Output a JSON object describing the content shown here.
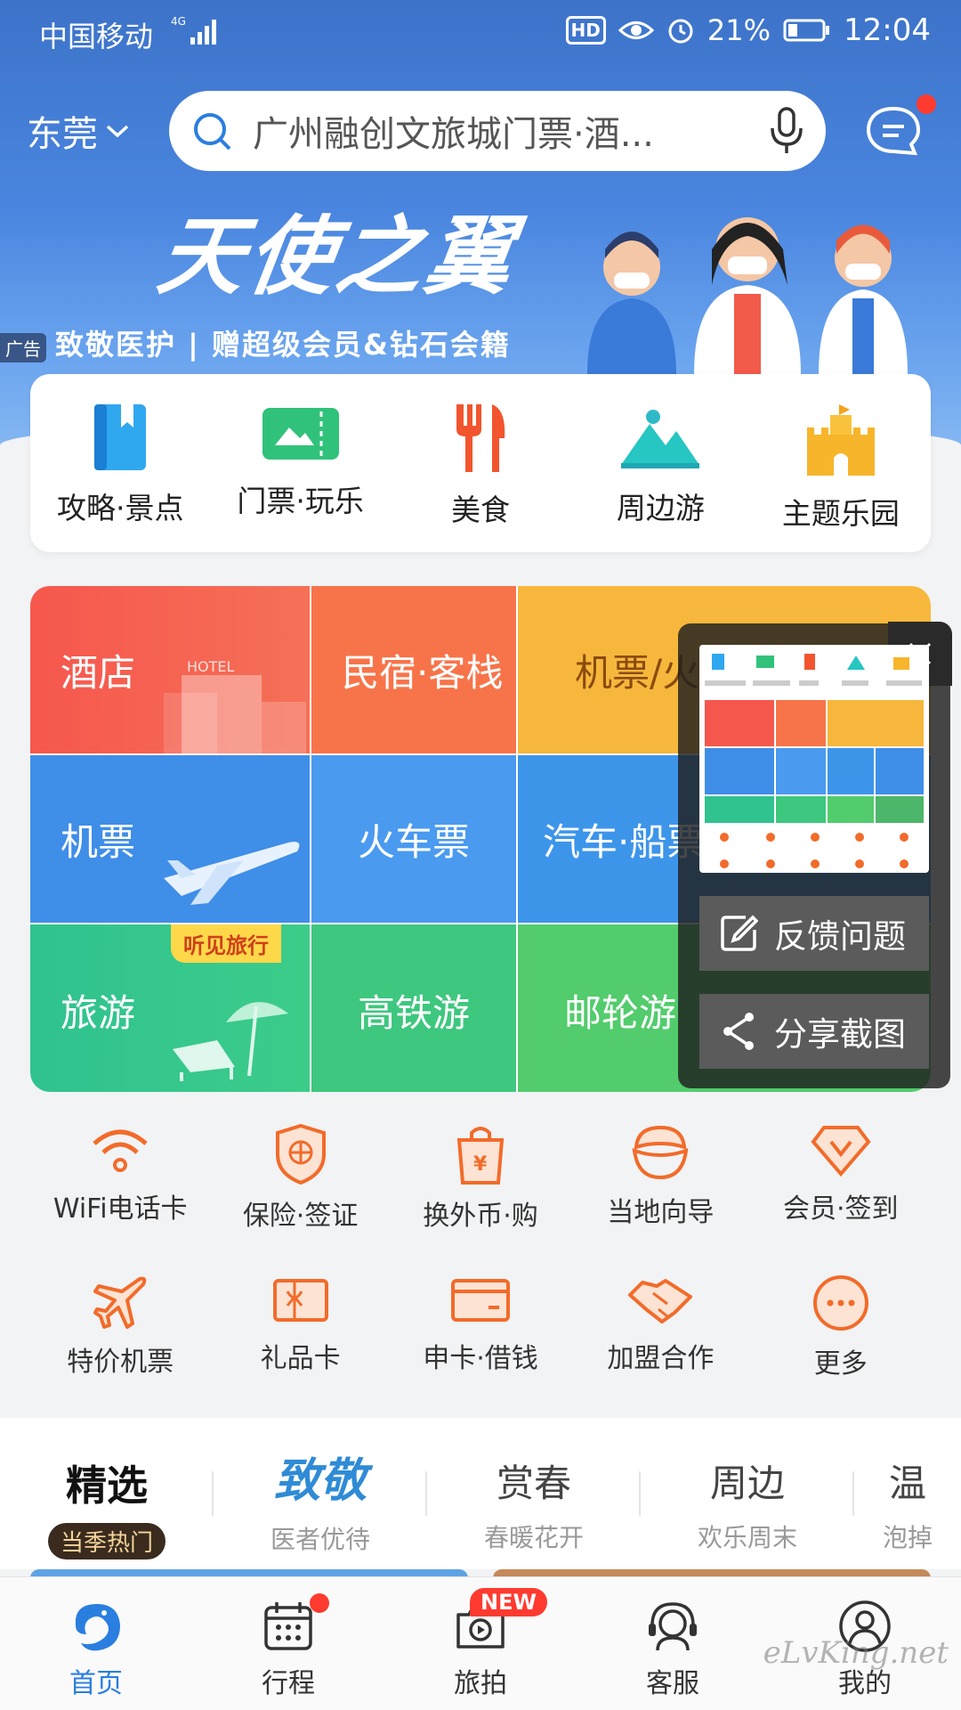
{
  "status_bar": {
    "carrier": "中国移动",
    "network": "4G",
    "battery": "21%",
    "time": "12:04",
    "hd": "HD"
  },
  "header": {
    "city": "东莞",
    "search_placeholder": "广州融创文旅城门票·酒..."
  },
  "banner": {
    "ad_tag": "广告",
    "title": "天使之翼",
    "subtitle": "致敬医护 | 赠超级会员&钻石会籍"
  },
  "categories": [
    {
      "label": "攻略·景点",
      "icon": "guide-book-icon"
    },
    {
      "label": "门票·玩乐",
      "icon": "ticket-icon"
    },
    {
      "label": "美食",
      "icon": "food-icon"
    },
    {
      "label": "周边游",
      "icon": "mountain-icon"
    },
    {
      "label": "主题乐园",
      "icon": "castle-icon"
    }
  ],
  "grid": {
    "hotel": "酒店",
    "homestay": "民宿·客栈",
    "flight_train": "机票/火",
    "flight": "机票",
    "train": "火车票",
    "bus_ship": "汽车·船票",
    "travel": "旅游",
    "travel_tag": "听见旅行",
    "hsr_tour": "高铁游",
    "cruise": "邮轮游",
    "hotel_sign": "HOTEL"
  },
  "float_panel": {
    "feedback": "反馈问题",
    "share": "分享截图"
  },
  "services": [
    {
      "label": "WiFi电话卡",
      "icon": "wifi-icon"
    },
    {
      "label": "保险·签证",
      "icon": "shield-icon"
    },
    {
      "label": "换外币·购",
      "icon": "shopping-bag-icon"
    },
    {
      "label": "当地向导",
      "icon": "guide-icon"
    },
    {
      "label": "会员·签到",
      "icon": "diamond-icon"
    },
    {
      "label": "特价机票",
      "icon": "plane-icon"
    },
    {
      "label": "礼品卡",
      "icon": "gift-card-icon"
    },
    {
      "label": "申卡·借钱",
      "icon": "credit-card-icon"
    },
    {
      "label": "加盟合作",
      "icon": "handshake-icon"
    },
    {
      "label": "更多",
      "icon": "more-icon"
    }
  ],
  "tabs": [
    {
      "title": "精选",
      "sub": "当季热门"
    },
    {
      "title": "致敬",
      "sub": "医者优待"
    },
    {
      "title": "赏春",
      "sub": "春暖花开"
    },
    {
      "title": "周边",
      "sub": "欢乐周末"
    },
    {
      "title": "温",
      "sub": "泡掉"
    }
  ],
  "bottom_nav": [
    {
      "label": "首页"
    },
    {
      "label": "行程"
    },
    {
      "label": "旅拍",
      "badge": "NEW"
    },
    {
      "label": "客服"
    },
    {
      "label": "我的"
    }
  ],
  "watermark": "eLvKing.net",
  "colors": {
    "brand_blue": "#2a7ee0",
    "service_orange": "#f26b2a",
    "badge_red": "#ff3b30"
  }
}
